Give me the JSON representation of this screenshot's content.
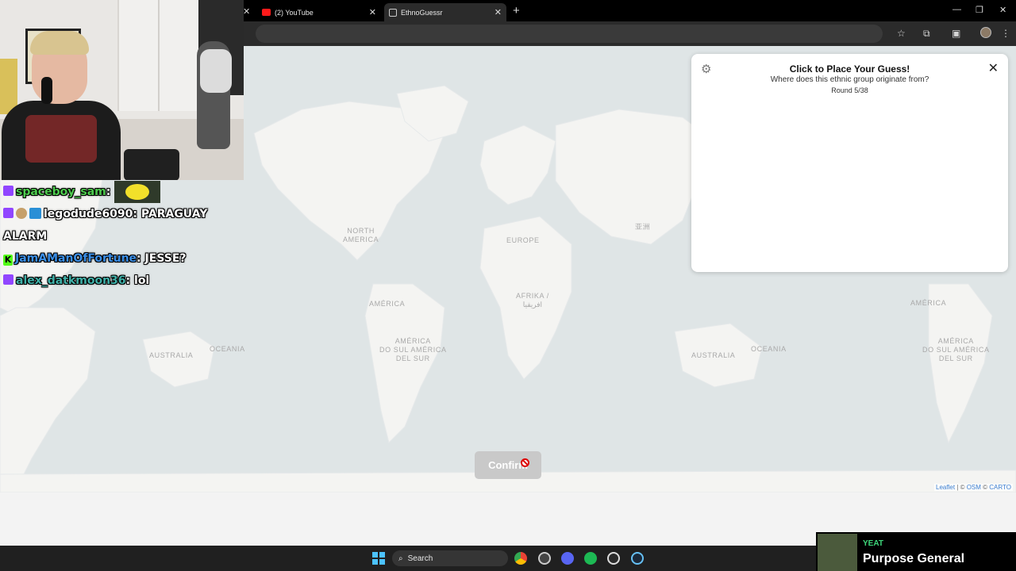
{
  "browser": {
    "tabs": [
      {
        "title": "(2) YouTube",
        "active": false
      },
      {
        "title": "EthnoGuessr",
        "active": true
      }
    ],
    "new_tab_symbol": "+",
    "window_controls": [
      "—",
      "❐",
      "✕"
    ]
  },
  "map": {
    "labels": [
      {
        "id": "north-america",
        "text": "NORTH\nAMERICA"
      },
      {
        "id": "europe",
        "text": "EUROPE"
      },
      {
        "id": "asia-cjk",
        "text": "亚洲"
      },
      {
        "id": "america-1",
        "text": "AMÉRICA"
      },
      {
        "id": "afrika",
        "text": "AFRIKA /\nافريقيا"
      },
      {
        "id": "south-america-1",
        "text": "AMÉRICA\nDO SUL AMÉRICA\nDEL SUR"
      },
      {
        "id": "australia-1",
        "text": "AUSTRALIA"
      },
      {
        "id": "oceania-1",
        "text": "OCEANIA"
      },
      {
        "id": "australia-2",
        "text": "AUSTRALIA"
      },
      {
        "id": "oceania-2",
        "text": "OCEANIA"
      },
      {
        "id": "america-2",
        "text": "AMÉRICA"
      },
      {
        "id": "south-america-2",
        "text": "AMÉRICA\nDO SUL AMÉRICA\nDEL SUR"
      }
    ],
    "attribution": {
      "leaflet": "Leaflet",
      "sep": " | © ",
      "osm": "OSM",
      "carto": "CARTO"
    },
    "confirm_label": "Confirm"
  },
  "guess_panel": {
    "title": "Click to Place Your Guess!",
    "subtitle": "Where does this ethnic group originate from?",
    "round": "Round 5/38"
  },
  "chat": {
    "messages": [
      {
        "user": "spaceboy_sam",
        "text": "",
        "user_color": "#4ecb4e"
      },
      {
        "user": "legodude6090",
        "text": "PARAGUAY",
        "user_color": "#e8e8e8"
      },
      {
        "user": "",
        "text": "ALARM",
        "user_color": "#e8e8e8"
      },
      {
        "user": "JamAManOfFortune",
        "text": "JESSE?",
        "user_color": "#3a8ee6"
      },
      {
        "user": "alex_datkmoon36",
        "text": "lol",
        "user_color": "#3fb0a8"
      }
    ]
  },
  "taskbar": {
    "search_placeholder": "Search"
  },
  "music": {
    "artist": "YEAT",
    "song": "Purpose General"
  },
  "colors": {
    "map_water": "#dfe5e6",
    "map_land": "#f4f4f2",
    "confirm_disabled": "#c9c9c9",
    "twitch": "#9146ff",
    "kick": "#53fc18",
    "spotify_green": "#3fd97c"
  }
}
